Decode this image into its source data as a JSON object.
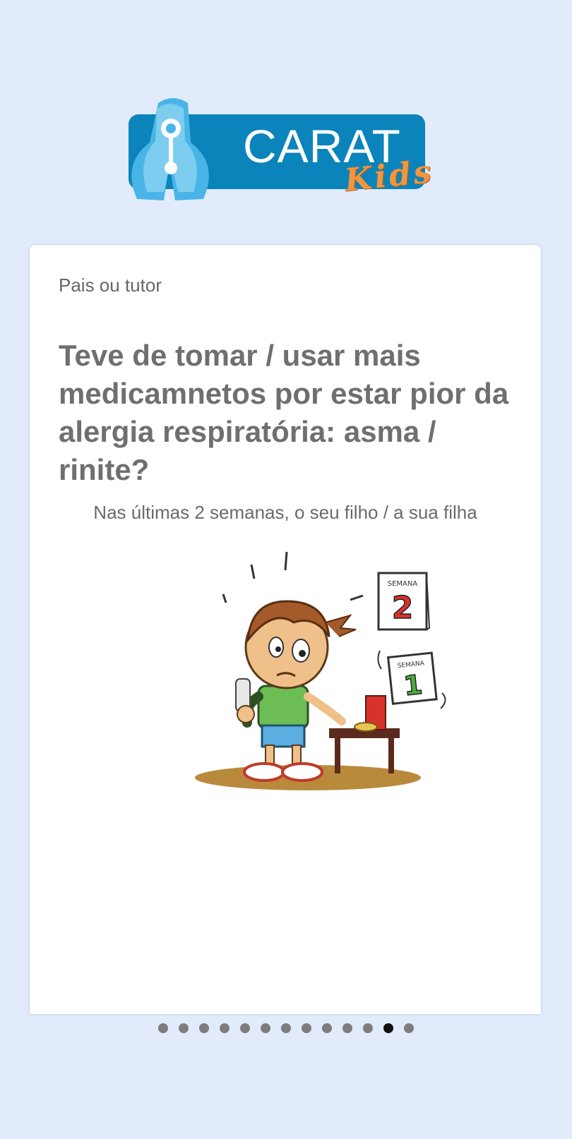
{
  "logo": {
    "text": "CARAT",
    "subtext": "Kids"
  },
  "card": {
    "role": "Pais ou tutor",
    "question": "Teve de tomar / usar mais medicamnetos por estar pior da alergia respiratória: asma / rinite?",
    "subtitle": "Nas últimas 2 semanas, o seu filho / a sua filha"
  },
  "illustration": {
    "calendar_top_label": "SEMANA",
    "calendar_top_number": "2",
    "calendar_bottom_label": "SEMANA",
    "calendar_bottom_number": "1"
  },
  "pagination": {
    "total": 13,
    "active_index": 11
  },
  "colors": {
    "brand_blue": "#0b84bb",
    "accent_orange": "#f2963d",
    "background": "#e1ebfc"
  }
}
